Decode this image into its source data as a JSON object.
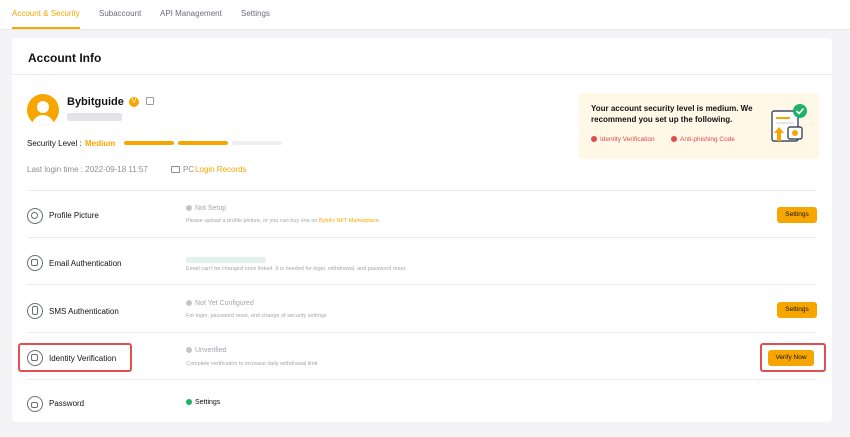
{
  "tabs": [
    "Account & Security",
    "Subaccount",
    "API Management",
    "Settings"
  ],
  "card": {
    "title": "Account Info",
    "username": "Bybitguide",
    "badge": "V",
    "security_label": "Security Level :",
    "security_level": "Medium",
    "last_login": "Last login time : 2022-09-18 11:57",
    "pc_label": "PC",
    "login_records_link": "Login Records"
  },
  "advice": {
    "text": "Your account security level is medium. We recommend you set up the following.",
    "items": [
      "Identity Verification",
      "Anti-phishing Code"
    ]
  },
  "rows": [
    {
      "label": "Profile Picture",
      "status": "Not Setup",
      "desc_prefix": "Please upload a profile picture, or you can buy one on ",
      "desc_link": "Bybit's NFT Marketplace",
      "desc_suffix": ".",
      "button": "Settings"
    },
    {
      "label": "Email Authentication",
      "desc": "Email can't be changed once linked. It is needed for login, withdrawal, and password reset."
    },
    {
      "label": "SMS Authentication",
      "status": "Not Yet Configured",
      "desc": "For login, password reset, and change of security settings",
      "button": "Settings"
    },
    {
      "label": "Identity Verification",
      "status": "Unverified",
      "desc": "Complete verification to increase daily withdrawal limit",
      "button": "Verify Now"
    },
    {
      "label": "Password",
      "status": "Settings"
    }
  ],
  "colors": {
    "accent": "#f7a600",
    "warning": "#e0484a",
    "success": "#20b26c",
    "highlight_frame": "#e05050"
  },
  "security_meter": {
    "filled_segments": 2,
    "total_segments": 3
  }
}
